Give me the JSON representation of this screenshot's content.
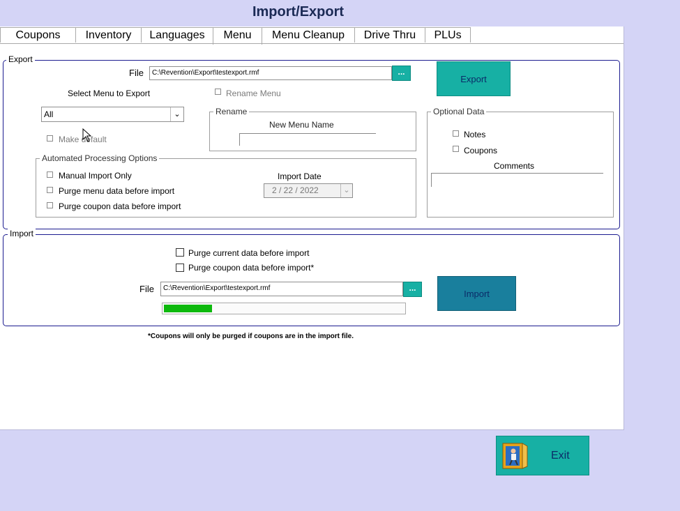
{
  "window": {
    "title": "Import/Export"
  },
  "tabs": [
    "Coupons",
    "Inventory",
    "Languages",
    "Menu",
    "Menu Cleanup",
    "Drive Thru",
    "PLUs"
  ],
  "active_tab": "Menu",
  "export": {
    "group_label": "Export",
    "file_label": "File",
    "file_value": "C:\\Revention\\Export\\testexport.rmf",
    "browse_label": "...",
    "export_button": "Export",
    "select_menu_label": "Select Menu to Export",
    "menu_selected": "All",
    "rename_menu_label": "Rename Menu",
    "make_default_label": "Make default",
    "rename_group": {
      "label": "Rename",
      "new_menu_name_label": "New Menu Name",
      "new_menu_name_value": ""
    },
    "optional_data": {
      "label": "Optional Data",
      "notes_label": "Notes",
      "coupons_label": "Coupons",
      "comments_label": "Comments",
      "comments_value": ""
    },
    "automated": {
      "label": "Automated Processing Options",
      "manual_import_only": "Manual Import Only",
      "purge_menu": "Purge menu data before import",
      "purge_coupon": "Purge coupon data before import",
      "import_date_label": "Import Date",
      "import_date_value": "2 / 22 / 2022"
    }
  },
  "import": {
    "group_label": "Import",
    "purge_current": "Purge current data before import",
    "purge_coupon": "Purge coupon data before import*",
    "file_label": "File",
    "file_value": "C:\\Revention\\Export\\testexport.rmf",
    "browse_label": "...",
    "import_button": "Import",
    "progress_fraction": 0.2
  },
  "footnote": "*Coupons will only be purged if coupons are in the import file.",
  "exit_button": "Exit",
  "colors": {
    "accent": "#17b0a4",
    "import_button": "#197f9d",
    "background": "#d4d4f6",
    "progress": "#0db90d"
  }
}
